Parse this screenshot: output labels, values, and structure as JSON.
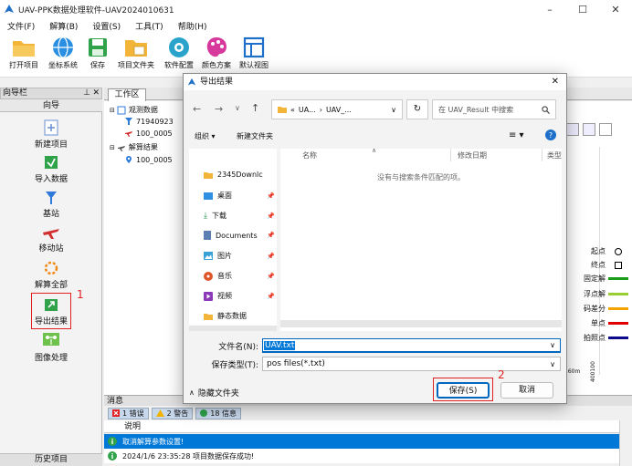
{
  "window": {
    "title": "UAV-PPK数据处理软件-UAV2024010631"
  },
  "menu": [
    "文件(F)",
    "解算(B)",
    "设置(S)",
    "工具(T)",
    "帮助(H)"
  ],
  "toolbar": [
    "打开项目",
    "坐标系统",
    "保存",
    "项目文件夹",
    "软件配置",
    "颜色方案",
    "默认视图"
  ],
  "nav": {
    "panel_title": "向导栏",
    "section_title": "向导",
    "items": [
      "新建项目",
      "导入数据",
      "基站",
      "移动站",
      "解算全部",
      "导出结果",
      "图像处理"
    ],
    "history_label": "历史项目"
  },
  "workspace": {
    "tab_label": "工作区",
    "tree": {
      "observations_label": "观测数据",
      "obs_item_1": "71940923",
      "obs_item_2": "100_0005",
      "results_label": "解算结果",
      "result_item_1": "100_0005"
    }
  },
  "legend": [
    {
      "label": "起点",
      "marker": "circle"
    },
    {
      "label": "终点",
      "marker": "square"
    },
    {
      "label": "固定解",
      "color": "#1a9e1a"
    },
    {
      "label": "浮点解",
      "color": "#9acd32"
    },
    {
      "label": "码差分",
      "color": "#f4a300"
    },
    {
      "label": "单点",
      "color": "#e00000"
    },
    {
      "label": "拍照点",
      "color": "#0a0a8a"
    }
  ],
  "plot": {
    "scale_label": "160m",
    "axis_value": "400100"
  },
  "messages": {
    "title": "消息",
    "tabs": {
      "errors": "1 错误",
      "warnings": "2 警告",
      "info": "18 信息"
    },
    "column": "说明",
    "rows": [
      {
        "text": "取消解算参数设置!",
        "selected": true
      },
      {
        "text": "2024/1/6 23:35:28  项目数据保存成功!",
        "selected": false
      }
    ]
  },
  "dialog": {
    "title": "导出结果",
    "address": {
      "prefix": "«",
      "seg1": "UA...",
      "sep": "›",
      "seg2": "UAV_..."
    },
    "search_placeholder": "在 UAV_Result 中搜索",
    "organize": "组织 ▾",
    "new_folder": "新建文件夹",
    "sidebar": [
      "2345Downlc",
      "桌面",
      "下载",
      "Documents",
      "图片",
      "音乐",
      "视频",
      "静态数据"
    ],
    "columns": {
      "name": "名称",
      "date": "修改日期",
      "type": "类型"
    },
    "empty_text": "没有与搜索条件匹配的项。",
    "filename_label": "文件名(N):",
    "filename_value": "UAV.txt",
    "filetype_label": "保存类型(T):",
    "filetype_value": "pos files(*.txt)",
    "hide_folders": "隐藏文件夹",
    "save": "保存(S)",
    "cancel": "取消"
  },
  "annotations": {
    "step1": "1",
    "step2": "2"
  }
}
